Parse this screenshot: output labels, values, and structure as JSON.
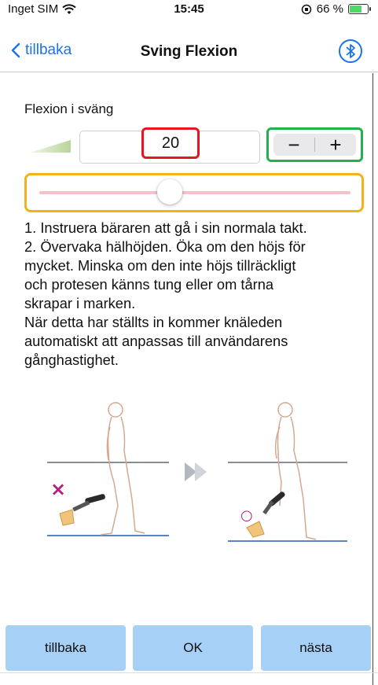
{
  "status_bar": {
    "carrier": "Inget SIM",
    "time": "15:45",
    "battery": "66 %",
    "battery_level": 0.66
  },
  "nav": {
    "back_label": "tillbaka",
    "title": "Sving Flexion",
    "bluetooth_icon": "bluetooth-icon"
  },
  "setting": {
    "label": "Flexion i sväng",
    "value": "20",
    "decrement_label": "−",
    "increment_label": "+",
    "slider_level": 0.42
  },
  "instructions": [
    "1. Instruera bäraren att gå i sin normala takt.",
    "2. Övervaka hälhöjden.  Öka om den höjs för",
    "mycket. Minska om den inte höjs tillräckligt",
    "och protesen känns tung eller om tårna",
    "skrapar i marken.",
    "När detta har ställts in kommer knäleden",
    "automatiskt att anpassas till användarens",
    "gånghastighet."
  ],
  "illustration": {
    "wrong_mark": "×",
    "right_mark": "○"
  },
  "buttons": {
    "back": "tillbaka",
    "ok": "OK",
    "next": "nästa"
  },
  "colors": {
    "accent": "#1a73e8",
    "value_highlight": "#e8141e",
    "stepper_highlight": "#22b24c",
    "slider_highlight": "#f3b21a",
    "button_bg": "#a6d0f5"
  }
}
